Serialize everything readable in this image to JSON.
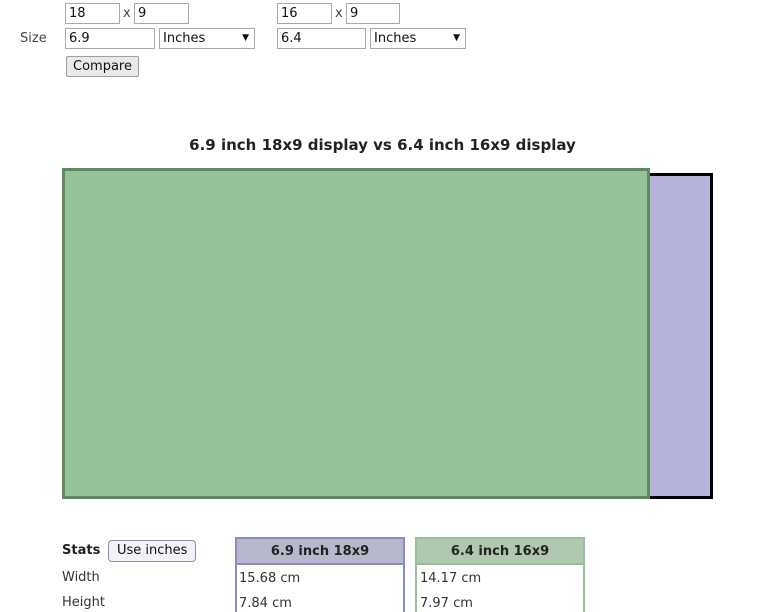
{
  "display1": {
    "ratio_w": "18",
    "ratio_h": "9",
    "size": "6.9",
    "unit": "Inches",
    "color": "#b3b3d9",
    "border": "#000000"
  },
  "display2": {
    "ratio_w": "16",
    "ratio_h": "9",
    "size": "6.4",
    "unit": "Inches",
    "color": "#96c299",
    "border": "#5e8a62"
  },
  "labels": {
    "x": "x",
    "size": "Size",
    "compare": "Compare",
    "stats": "Stats",
    "use_inches": "Use inches"
  },
  "comparison": {
    "title": "6.9 inch 18x9 display vs 6.4 inch 16x9 display"
  },
  "stats": {
    "columns": [
      {
        "name": "6.9 inch 18x9",
        "head_bg": "#b8b8cc",
        "border": "#8c8cc0"
      },
      {
        "name": "6.4 inch 16x9",
        "head_bg": "#b0c8b0",
        "border": "#96c299"
      }
    ],
    "rows": [
      {
        "label": "Width",
        "values": [
          "15.68 cm",
          "14.17 cm"
        ]
      },
      {
        "label": "Height",
        "values": [
          "7.84 cm",
          "7.97 cm"
        ]
      }
    ]
  }
}
